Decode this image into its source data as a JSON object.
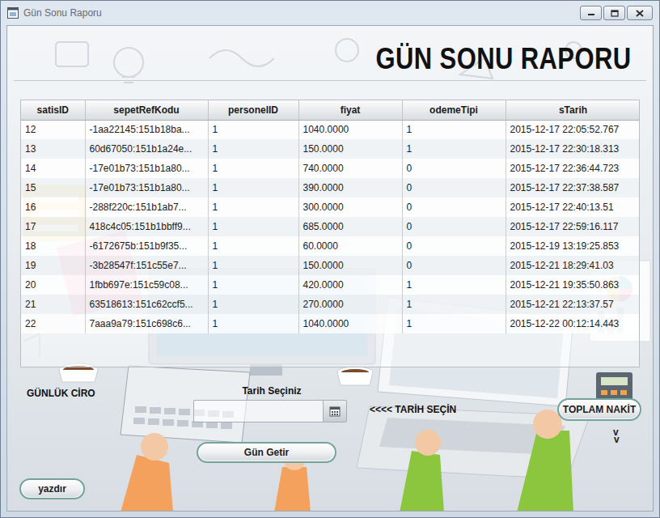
{
  "window": {
    "title": "Gün Sonu Raporu"
  },
  "header": {
    "title": "GÜN SONU RAPORU"
  },
  "table": {
    "columns": [
      "satisID",
      "sepetRefKodu",
      "personelID",
      "fiyat",
      "odemeTipi",
      "sTarih"
    ],
    "rows": [
      [
        "12",
        "-1aa22145:151b18ba...",
        "1",
        "1040.0000",
        "1",
        "2015-12-17 22:05:52.767"
      ],
      [
        "13",
        "60d67050:151b1a24e...",
        "1",
        "150.0000",
        "1",
        "2015-12-17 22:30:18.313"
      ],
      [
        "14",
        "-17e01b73:151b1a80...",
        "1",
        "740.0000",
        "0",
        "2015-12-17 22:36:44.723"
      ],
      [
        "15",
        "-17e01b73:151b1a80...",
        "1",
        "390.0000",
        "0",
        "2015-12-17 22:37:38.587"
      ],
      [
        "16",
        "-288f220c:151b1ab7...",
        "1",
        "300.0000",
        "0",
        "2015-12-17 22:40:13.51"
      ],
      [
        "17",
        "418c4c05:151b1bbff9...",
        "1",
        "685.0000",
        "0",
        "2015-12-17 22:59:16.117"
      ],
      [
        "18",
        "-6172675b:151b9f35...",
        "1",
        "60.0000",
        "0",
        "2015-12-19 13:19:25.853"
      ],
      [
        "19",
        "-3b28547f:151c55e7...",
        "1",
        "150.0000",
        "0",
        "2015-12-21 18:29:41.03"
      ],
      [
        "20",
        "1fbb697e:151c59c08...",
        "1",
        "420.0000",
        "1",
        "2015-12-21 19:35:50.863"
      ],
      [
        "21",
        "63518613:151c62ccf5...",
        "1",
        "270.0000",
        "1",
        "2015-12-21 22:13:37.57"
      ],
      [
        "22",
        "7aaa9a79:151c698c6...",
        "1",
        "1040.0000",
        "1",
        "2015-12-22 00:12:14.443"
      ]
    ]
  },
  "daily_revenue": {
    "label": "GÜNLÜK CİRO"
  },
  "date_picker": {
    "label": "Tarih Seçiniz",
    "hint": "<<<< TARİH SEÇİN"
  },
  "buttons": {
    "total_cash": "TOPLAM NAKİT",
    "fetch_day": "Gün Getir",
    "print": "yazdır"
  },
  "arrows": [
    "v",
    "v"
  ]
}
